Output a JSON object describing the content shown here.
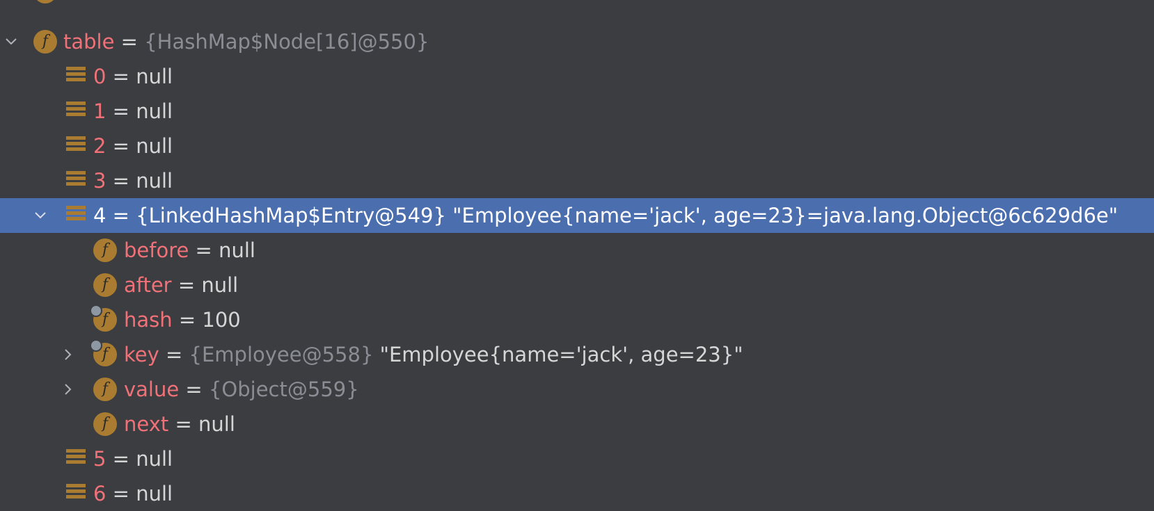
{
  "debugger": {
    "rows": [
      {
        "id": "top_partial",
        "name": "",
        "eq": "",
        "type": "",
        "value": ""
      },
      {
        "id": "table",
        "name": "table",
        "eq": " = ",
        "type": "{HashMap$Node[16]@550}",
        "value": ""
      },
      {
        "id": "i0",
        "name": "0",
        "eq": " = ",
        "type": "",
        "value": "null"
      },
      {
        "id": "i1",
        "name": "1",
        "eq": " = ",
        "type": "",
        "value": "null"
      },
      {
        "id": "i2",
        "name": "2",
        "eq": " = ",
        "type": "",
        "value": "null"
      },
      {
        "id": "i3",
        "name": "3",
        "eq": " = ",
        "type": "",
        "value": "null"
      },
      {
        "id": "i4",
        "name": "4",
        "eq": " = ",
        "type": "{LinkedHashMap$Entry@549}",
        "value": " \"Employee{name='jack', age=23}=java.lang.Object@6c629d6e\""
      },
      {
        "id": "before",
        "name": "before",
        "eq": " = ",
        "type": "",
        "value": "null"
      },
      {
        "id": "after",
        "name": "after",
        "eq": " = ",
        "type": "",
        "value": "null"
      },
      {
        "id": "hash",
        "name": "hash",
        "eq": " = ",
        "type": "",
        "value": "100"
      },
      {
        "id": "key",
        "name": "key",
        "eq": " = ",
        "type": "{Employee@558}",
        "value": " \"Employee{name='jack', age=23}\""
      },
      {
        "id": "value",
        "name": "value",
        "eq": " = ",
        "type": "{Object@559}",
        "value": ""
      },
      {
        "id": "next",
        "name": "next",
        "eq": " = ",
        "type": "",
        "value": "null"
      },
      {
        "id": "i5",
        "name": "5",
        "eq": " = ",
        "type": "",
        "value": "null"
      },
      {
        "id": "i6",
        "name": "6",
        "eq": " = ",
        "type": "",
        "value": "null"
      }
    ]
  },
  "colors": {
    "background": "#3b3d41",
    "selection": "#4b6eaf",
    "name": "#f07178",
    "type": "#8a8d93",
    "icon": "#a97c32"
  },
  "icons": {
    "field": "field-f-icon",
    "final_field": "final-field-icon",
    "array_element": "array-element-icon",
    "expand": "chevron-down-icon",
    "collapsed": "chevron-right-icon"
  }
}
